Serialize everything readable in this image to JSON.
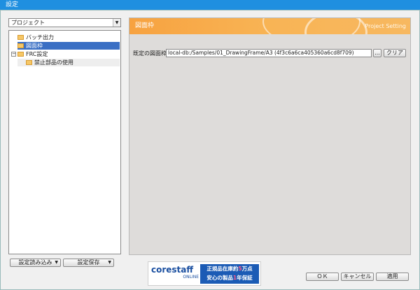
{
  "window": {
    "title": "設定"
  },
  "left": {
    "project_select": "プロジェクト",
    "tree": [
      {
        "label": "バッチ出力",
        "selected": false
      },
      {
        "label": "図面枠",
        "selected": true
      },
      {
        "label": "FRC設定",
        "selected": false,
        "expander": "−"
      },
      {
        "label": "禁止部品の使用",
        "selected": false
      }
    ],
    "load_button": "設定読み込み",
    "save_button": "設定保存"
  },
  "panel": {
    "banner_title": "図面枠",
    "banner_subtitle": "Project Setting",
    "field_label": "既定の図面枠",
    "field_value": "local-db:/Samples/01_DrawingFrame/A3 (4f3c6a6ca405360a6cd8f709)",
    "browse_button": "...",
    "clear_button": "クリア"
  },
  "ad": {
    "brand": "corestaff",
    "brand_sub": "ONLINE",
    "line1_a": "正規品在庫約",
    "line1_num": "5",
    "line1_b": "万点",
    "line2_a": "安心の製品",
    "line2_num": "1",
    "line2_b": "年保証"
  },
  "footer": {
    "ok": "ＯＫ",
    "cancel": "キャンセル",
    "apply": "適用"
  },
  "colors": {
    "titlebar": "#1f8fe0",
    "selection": "#3a6fc4",
    "banner": "#f7a240"
  }
}
